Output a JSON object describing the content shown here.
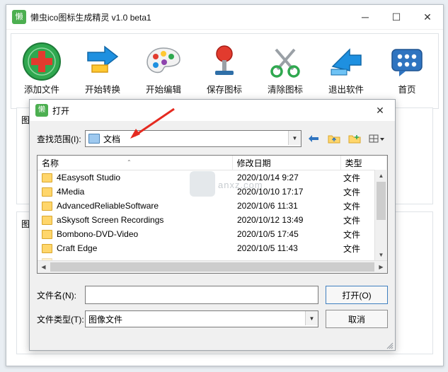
{
  "app": {
    "title": "懒虫ico图标生成精灵 v1.0 beta1",
    "icon_name": "app-logo-icon",
    "icon_glyph": "懒",
    "window_buttons": {
      "minimize": "─",
      "maximize": "☐",
      "close": "✕"
    },
    "toolbar": [
      {
        "label": "添加文件",
        "icon": "add-file-icon"
      },
      {
        "label": "开始转换",
        "icon": "convert-arrow-icon"
      },
      {
        "label": "开始编辑",
        "icon": "palette-icon"
      },
      {
        "label": "保存图标",
        "icon": "save-pin-icon"
      },
      {
        "label": "清除图标",
        "icon": "scissors-icon"
      },
      {
        "label": "退出软件",
        "icon": "exit-arrow-icon"
      },
      {
        "label": "首页",
        "icon": "home-chat-icon"
      }
    ],
    "panels": {
      "left_label": "图",
      "bottom_label": "图"
    }
  },
  "dialog": {
    "title": "打开",
    "icon_glyph": "懒",
    "close_label": "✕",
    "lookin": {
      "label": "查找范围(I):",
      "value": "文档",
      "arrow": "▼",
      "buttons": [
        {
          "name": "back-button",
          "glyph": "←"
        },
        {
          "name": "up-folder-button",
          "glyph": "↑"
        },
        {
          "name": "new-folder-button",
          "glyph": "➕"
        },
        {
          "name": "view-mode-button",
          "glyph": "▤"
        }
      ]
    },
    "columns": [
      "名称",
      "修改日期",
      "类型"
    ],
    "sort_caret": "⌃",
    "files": [
      {
        "name": "4Easysoft Studio",
        "date": "2020/10/14 9:27",
        "type": "文件"
      },
      {
        "name": "4Media",
        "date": "2020/10/10 17:17",
        "type": "文件"
      },
      {
        "name": "AdvancedReliableSoftware",
        "date": "2020/10/6 11:31",
        "type": "文件"
      },
      {
        "name": "aSkysoft Screen Recordings",
        "date": "2020/10/12 13:49",
        "type": "文件"
      },
      {
        "name": "Bombono-DVD-Video",
        "date": "2020/10/5 17:45",
        "type": "文件"
      },
      {
        "name": "Craft Edge",
        "date": "2020/10/5 11:43",
        "type": "文件"
      }
    ],
    "filename": {
      "label": "文件名(N):",
      "value": "",
      "placeholder": ""
    },
    "filetype": {
      "label": "文件类型(T):",
      "value": "图像文件",
      "arrow": "▼"
    },
    "open_button": "打开(O)",
    "cancel_button": "取消",
    "scroll": {
      "up": "▲",
      "down": "▼",
      "left": "◀",
      "right": "▶"
    }
  },
  "watermark": {
    "text": "anxz.com"
  },
  "colors": {
    "accent_green": "#4caf50",
    "folder_yellow": "#ffd66b",
    "arrow_red": "#e52a20",
    "titlebar_bg": "#ffffff",
    "dialog_bg": "#f0f0f0",
    "desktop_bg": "#e9eef3"
  }
}
